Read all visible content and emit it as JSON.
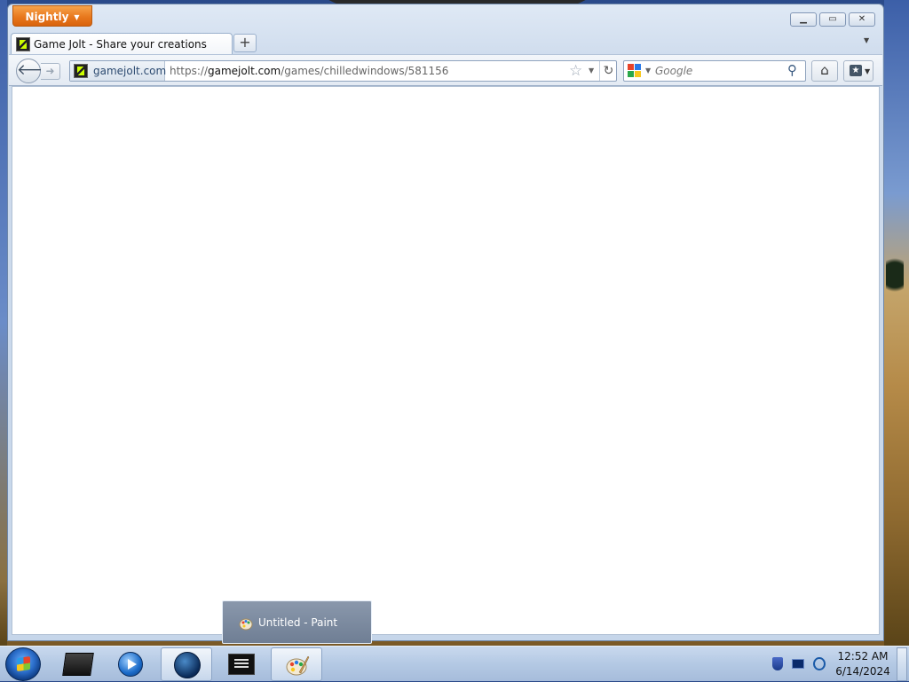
{
  "browser": {
    "app_menu_label": "Nightly",
    "tab": {
      "title": "Game Jolt - Share your creations"
    },
    "url_bar": {
      "identity_domain": "gamejolt.com",
      "url_prefix": "https://",
      "url_host": "gamejolt.com",
      "url_path": "/games/chilledwindows/581156"
    },
    "search_bar": {
      "placeholder": "Google"
    }
  },
  "thumbnail_popup": {
    "title": "Untitled - Paint"
  },
  "taskbar": {
    "items": [
      "terminal",
      "media-player",
      "globe-browser",
      "command-prompt",
      "paint"
    ],
    "clock": {
      "time": "12:52 AM",
      "date": "6/14/2024"
    }
  },
  "colors": {
    "app_menu": "#e8781d",
    "taskbar": "#b4c9e4",
    "window_chrome": "#cfdced"
  }
}
